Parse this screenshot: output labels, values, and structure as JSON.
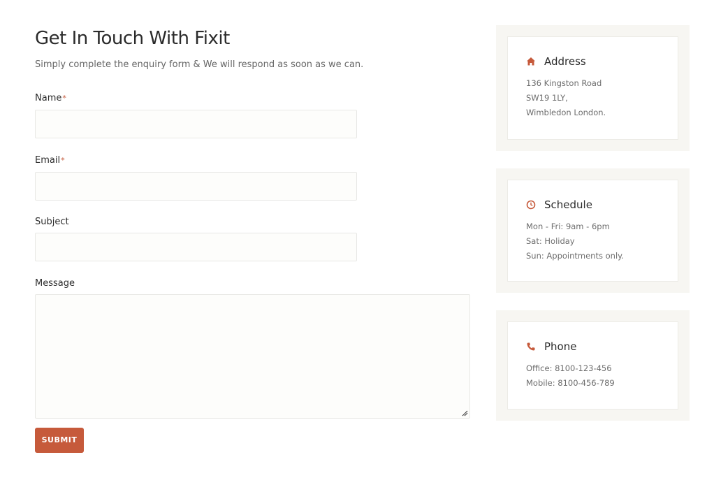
{
  "contact_form": {
    "title": "Get In Touch With Fixit",
    "subtitle": "Simply complete the enquiry form & We will respond as soon as we can.",
    "fields": {
      "name_label": "Name",
      "email_label": "Email",
      "subject_label": "Subject",
      "message_label": "Message",
      "required_marker": "*"
    },
    "submit_label": "SUBMIT"
  },
  "info_cards": {
    "address": {
      "title": "Address",
      "icon": "home-icon",
      "lines": [
        "136 Kingston Road",
        "SW19 1LY,",
        "Wimbledon London."
      ]
    },
    "schedule": {
      "title": "Schedule",
      "icon": "clock-icon",
      "lines": [
        "Mon - Fri: 9am - 6pm",
        "Sat: Holiday",
        "Sun: Appointments only."
      ]
    },
    "phone": {
      "title": "Phone",
      "icon": "phone-icon",
      "lines": [
        "Office: 8100-123-456",
        "Mobile: 8100-456-789"
      ]
    }
  },
  "colors": {
    "accent": "#c65a3b",
    "card_bg": "#f7f6f2",
    "input_bg": "#fdfdfb"
  }
}
